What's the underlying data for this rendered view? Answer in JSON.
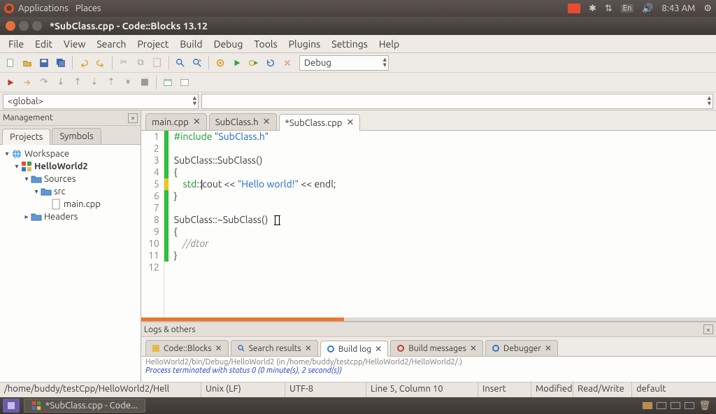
{
  "panel": {
    "applications": "Applications",
    "places": "Places",
    "time": "8:43 AM",
    "lang": "En"
  },
  "window": {
    "title": "*SubClass.cpp - Code::Blocks 13.12"
  },
  "menu": [
    "File",
    "Edit",
    "View",
    "Search",
    "Project",
    "Build",
    "Debug",
    "Tools",
    "Plugins",
    "Settings",
    "Help"
  ],
  "buildTarget": "Debug",
  "scope": "<global>",
  "mgmt": {
    "title": "Management",
    "tabs": [
      "Projects",
      "Symbols"
    ],
    "workspace": "Workspace",
    "project": "HelloWorld2",
    "folders": {
      "sources": "Sources",
      "src": "src",
      "main": "main.cpp",
      "headers": "Headers"
    }
  },
  "files": [
    {
      "name": "main.cpp",
      "active": false
    },
    {
      "name": "SubClass.h",
      "active": false
    },
    {
      "name": "*SubClass.cpp",
      "active": true
    }
  ],
  "code": {
    "l1a": "#include ",
    "l1b": "\"SubClass.h\"",
    "l3": "SubClass::SubClass()",
    "l4": "{",
    "l5a": "    std",
    "l5b": "::",
    "l5c": "cout << ",
    "l5d": "\"Hello world!\"",
    "l5e": " << endl;",
    "l6": "}",
    "l8": "SubClass::~SubClass()",
    "l9": "{",
    "l10a": "    ",
    "l10b": "//dtor",
    "l11": "}"
  },
  "logs": {
    "title": "Logs & others",
    "tabs": [
      "Code::Blocks",
      "Search results",
      "Build log",
      "Build messages",
      "Debugger"
    ],
    "line1": "HelloWorld2/bin/Debug/HelloWorld2  (in /home/buddy/testcpp/HelloWorld2/HelloWorld2/.)",
    "line2": "Process terminated with status 0 (0 minute(s), 2 second(s))"
  },
  "status": {
    "path": "/home/buddy/testCpp/HelloWorld2/Hell",
    "eol": "Unix (LF)",
    "enc": "UTF-8",
    "pos": "Line 5, Column 10",
    "ins": "Insert",
    "mod": "Modified",
    "rw": "Read/Write",
    "prof": "default"
  },
  "taskbar": {
    "task": "*SubClass.cpp - Code..."
  }
}
